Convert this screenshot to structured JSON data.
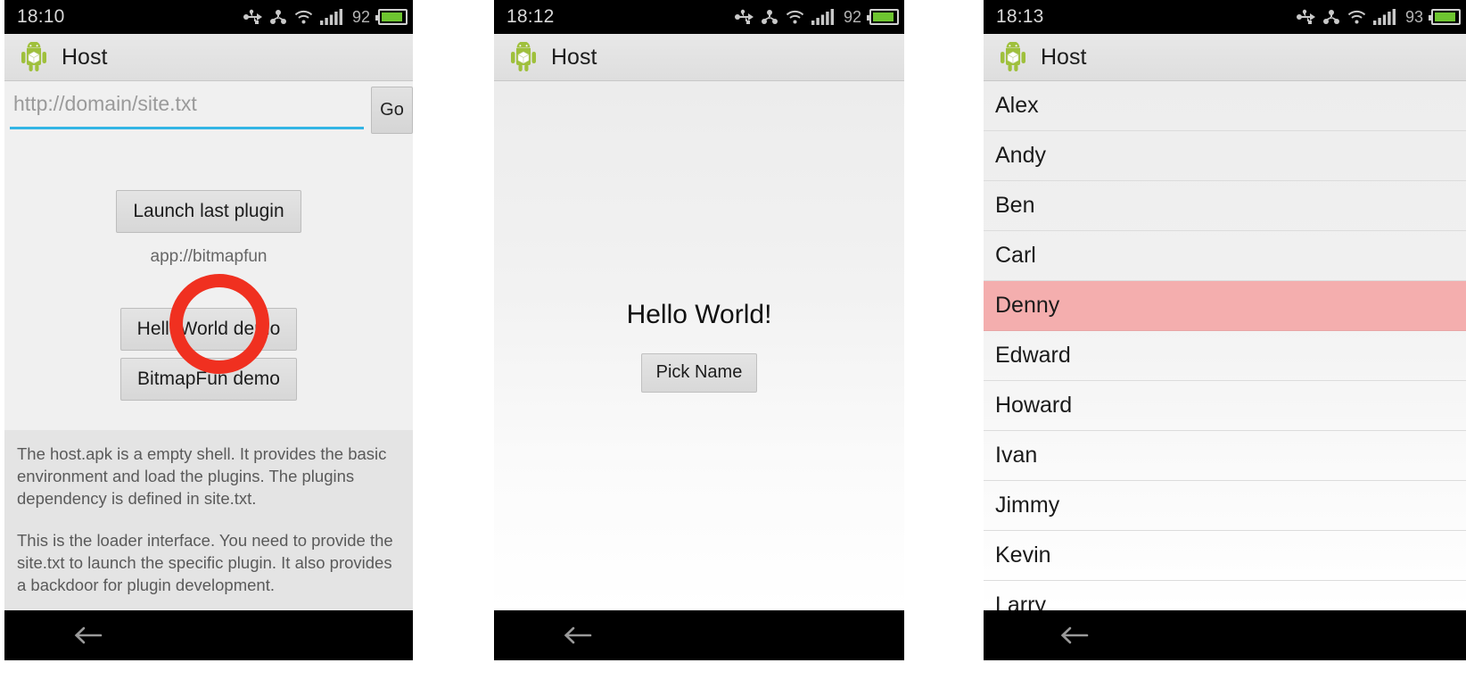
{
  "panels": [
    {
      "id": "panel-host-loader",
      "status": {
        "time": "18:10",
        "battery_percent": "92",
        "icons": [
          "usb-icon",
          "debug-icon",
          "wifi-icon",
          "signal-icon",
          "battery-icon"
        ]
      },
      "actionbar": {
        "icon": "android-app-icon",
        "title": "Host"
      },
      "url_input": {
        "placeholder": "http://domain/site.txt",
        "value": ""
      },
      "go_button": "Go",
      "launch_last_button": "Launch last plugin",
      "last_plugin_uri": "app://bitmapfun",
      "helloworld_button": "HelloWorld demo",
      "bitmapfun_button": "BitmapFun demo",
      "info_paragraphs": [
        "The host.apk is a empty shell. It provides the basic environment and load the plugins. The plugins dependency is defined in site.txt.",
        "This is the loader interface. You need to provide the site.txt to launch the specific plugin. It also provides a backdoor for plugin development."
      ],
      "nav": {
        "back": "back-arrow-icon"
      },
      "annotation": {
        "type": "circle",
        "color": "#f03020",
        "target": "helloworld-demo-button"
      }
    },
    {
      "id": "panel-helloworld-plugin",
      "status": {
        "time": "18:12",
        "battery_percent": "92",
        "icons": [
          "usb-icon",
          "debug-icon",
          "wifi-icon",
          "signal-icon",
          "battery-icon"
        ]
      },
      "actionbar": {
        "icon": "android-app-icon",
        "title": "Host"
      },
      "hello_text": "Hello World!",
      "pick_button": "Pick Name",
      "nav": {
        "back": "back-arrow-icon"
      }
    },
    {
      "id": "panel-name-list",
      "status": {
        "time": "18:13",
        "battery_percent": "93",
        "icons": [
          "usb-icon",
          "debug-icon",
          "wifi-icon",
          "signal-icon",
          "battery-icon"
        ]
      },
      "actionbar": {
        "icon": "android-app-icon",
        "title": "Host"
      },
      "names": [
        "Alex",
        "Andy",
        "Ben",
        "Carl",
        "Denny",
        "Edward",
        "Howard",
        "Ivan",
        "Jimmy",
        "Kevin",
        "Larry"
      ],
      "selected_name": "Denny",
      "selected_color": "#f4aeae",
      "nav": {
        "back": "back-arrow-icon"
      }
    }
  ],
  "colors": {
    "accent_underline": "#33b5e5",
    "annotation_red": "#f03020",
    "selected_row": "#f4aeae",
    "battery_green": "#6ec530"
  }
}
